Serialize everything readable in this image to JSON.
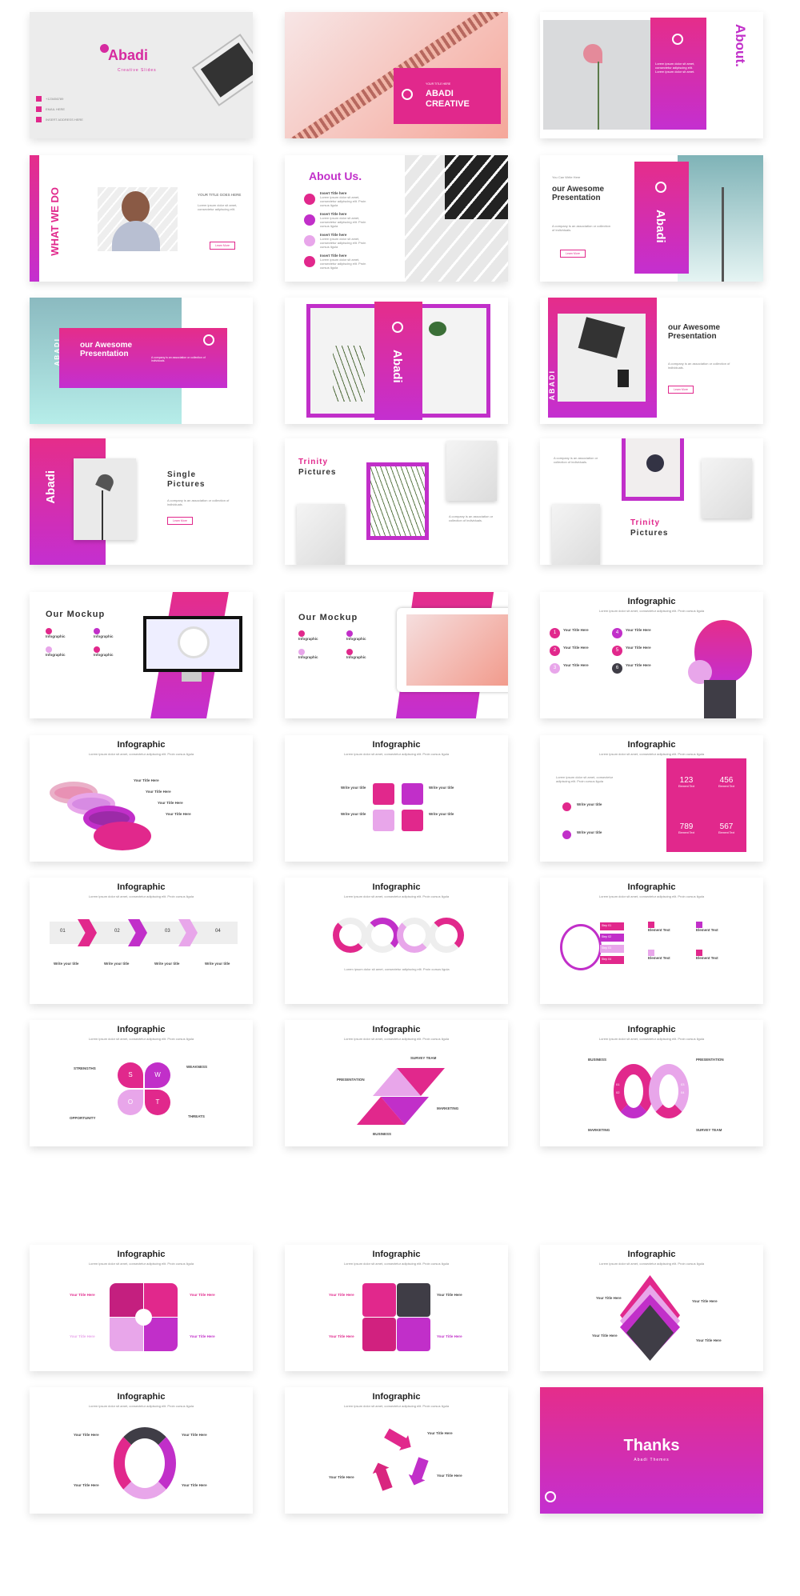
{
  "colors": {
    "pink": "#e1288c",
    "purple": "#c12fc9",
    "light_pink": "#e8a6ea",
    "dark": "#3f3d46"
  },
  "s1": {
    "brand": "Abadi",
    "tagline": "Creative Slides",
    "contacts": [
      "+123456789",
      "EMAIL HERE",
      "INSERT ADDRESS HERE"
    ],
    "icons": [
      "phone-icon",
      "mail-icon",
      "address-icon"
    ]
  },
  "s2": {
    "kicker": "YOUR TITLE HERE",
    "title_line1": "ABADI",
    "title_line2": "CREATIVE"
  },
  "s3": {
    "title": "About.",
    "body": "Lorem ipsum dolor sit amet, consectetur adipiscing elit. Lorem ipsum dolor sit amet."
  },
  "s4": {
    "title": "WHAT WE DO",
    "heading": "YOUR TITLE GOES HERE",
    "body": "Lorem ipsum dolor sit amet, consectetur adipiscing elit.",
    "button": "Learn More"
  },
  "s5": {
    "title": "About Us.",
    "items": [
      {
        "title": "Insert Title here"
      },
      {
        "title": "Insert Title here"
      },
      {
        "title": "Insert Title here"
      },
      {
        "title": "Insert Title here"
      }
    ]
  },
  "s6": {
    "kicker": "You Can Write Here",
    "title": "our Awesome Presentation",
    "body": "A company is an association or collection of individuals.",
    "button": "Learn More",
    "vertical": "Abadi"
  },
  "s7": {
    "vertical": "ABADI",
    "title": "our Awesome Presentation",
    "body": "A company is an association or collection of individuals."
  },
  "s8": {
    "vertical": "Abadi"
  },
  "s9": {
    "vertical": "ABADI",
    "title": "our Awesome Presentation",
    "body": "A company is an association or collection of individuals.",
    "button": "Learn More"
  },
  "s10": {
    "vertical": "Abadi",
    "title": "Single Pictures",
    "body": "A company is an association or collection of individuals.",
    "button": "Learn More"
  },
  "s11": {
    "title_a": "Trinity",
    "title_b": "Pictures",
    "body": "A company is an association or collection of individuals."
  },
  "s12": {
    "title_a": "Trinity",
    "title_b": "Pictures",
    "body": "A company is an association or collection of individuals."
  },
  "s13": {
    "title": "Our Mockup",
    "items": [
      "Infographic",
      "Infographic",
      "Infographic",
      "Infographic"
    ]
  },
  "s14": {
    "title": "Our Mockup",
    "items": [
      "Infographic",
      "Infographic",
      "Infographic",
      "Infographic"
    ]
  },
  "infographic": {
    "title": "Infographic",
    "subtitle": "Lorem ipsum dolor sit amet, consectetur adipiscing elit. Proin cursus ligula"
  },
  "s15": {
    "numbers": [
      "1",
      "2",
      "3",
      "4",
      "5",
      "6"
    ],
    "item_title": "Your Title Here"
  },
  "s16": {
    "item_title": "Your Title Here"
  },
  "s17": {
    "item_title": "Write your title"
  },
  "s18": {
    "numbers": [
      "123",
      "456",
      "789",
      "567"
    ],
    "item_title": "Write your title",
    "cell_label": "Element Text"
  },
  "s19": {
    "steps": [
      "01",
      "02",
      "03",
      "04"
    ],
    "item_title": "Write your title"
  },
  "s21": {
    "steps": [
      "Step 01",
      "Step 02",
      "Step 03",
      "Step 04"
    ],
    "item_title": "Element Text"
  },
  "s22": {
    "letters": [
      "S",
      "W",
      "O",
      "T"
    ],
    "labels": [
      "STRENGTHS",
      "WEAKNESS",
      "OPPORTUNITY",
      "THREATS"
    ]
  },
  "s23": {
    "labels": [
      "SURVEY TEAM",
      "PRESENTATION",
      "MARKETING",
      "BUSINESS"
    ]
  },
  "s24": {
    "labels": [
      "BUSINESS",
      "PRESENTATION",
      "MARKETING",
      "SURVEY TEAM"
    ],
    "numbers": [
      "01",
      "02",
      "03",
      "04"
    ]
  },
  "s25": {
    "item_title": "Your Title Here"
  },
  "s30": {
    "title": "Thanks",
    "subtitle": "Abadi Themes"
  }
}
